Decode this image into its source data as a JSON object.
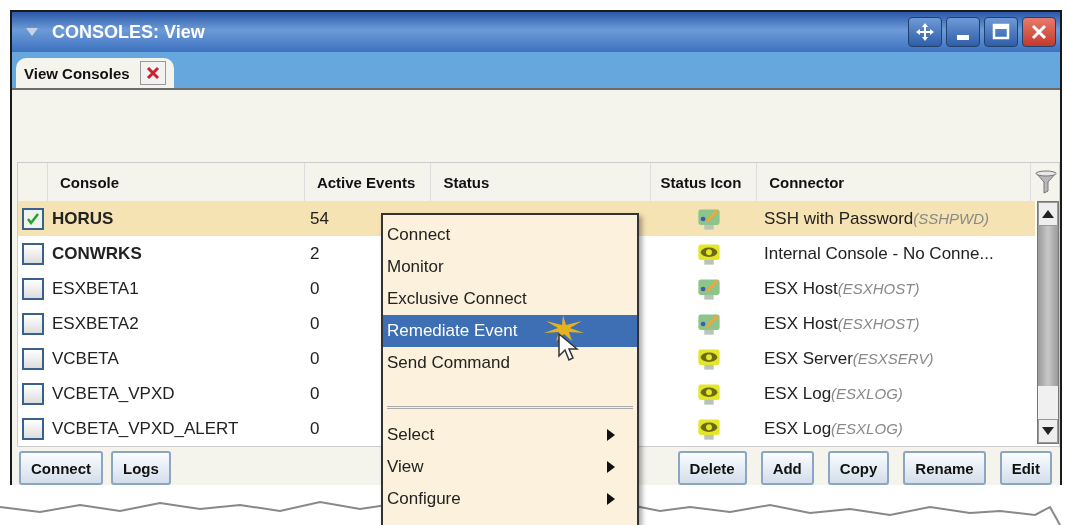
{
  "window": {
    "title": "CONSOLES: View"
  },
  "tabs": [
    {
      "label": "View Consoles",
      "selected": true
    }
  ],
  "table": {
    "columns": [
      "Console",
      "Active Events",
      "Status",
      "Status Icon",
      "Connector"
    ],
    "rows": [
      {
        "checked": true,
        "selected": true,
        "emphasized": true,
        "console": "HORUS",
        "active_events": "54",
        "status_icon": {
          "kind": "edit"
        },
        "connector": "SSH with Password",
        "connector_code": "(SSHPWD)"
      },
      {
        "checked": false,
        "selected": false,
        "emphasized": true,
        "console": "CONWRKS",
        "active_events": "2",
        "status_icon": {
          "kind": "watch"
        },
        "connector": "Internal Console - No Conne...",
        "connector_code": ""
      },
      {
        "checked": false,
        "selected": false,
        "emphasized": false,
        "console": "ESXBETA1",
        "active_events": "0",
        "status_icon": {
          "kind": "edit"
        },
        "connector": "ESX Host",
        "connector_code": "(ESXHOST)"
      },
      {
        "checked": false,
        "selected": false,
        "emphasized": false,
        "console": "ESXBETA2",
        "active_events": "0",
        "status_icon": {
          "kind": "edit"
        },
        "connector": "ESX Host",
        "connector_code": "(ESXHOST)"
      },
      {
        "checked": false,
        "selected": false,
        "emphasized": false,
        "console": "VCBETA",
        "active_events": "0",
        "status_icon": {
          "kind": "watch"
        },
        "connector": "ESX Server",
        "connector_code": "(ESXSERV)"
      },
      {
        "checked": false,
        "selected": false,
        "emphasized": false,
        "console": "VCBETA_VPXD",
        "active_events": "0",
        "status_icon": {
          "kind": "watch"
        },
        "connector": "ESX Log",
        "connector_code": "(ESXLOG)"
      },
      {
        "checked": false,
        "selected": false,
        "emphasized": false,
        "console": "VCBETA_VPXD_ALERT",
        "active_events": "0",
        "status_icon": {
          "kind": "watch"
        },
        "connector": "ESX Log",
        "connector_code": "(ESXLOG)"
      }
    ]
  },
  "left_buttons": [
    "Connect",
    "Logs"
  ],
  "right_buttons": [
    "Delete",
    "Add",
    "Copy",
    "Rename",
    "Edit"
  ],
  "context_menu": {
    "items": [
      {
        "kind": "item",
        "label": "Connect",
        "selected": false
      },
      {
        "kind": "item",
        "label": "Monitor",
        "selected": false
      },
      {
        "kind": "item",
        "label": "Exclusive Connect",
        "selected": false
      },
      {
        "kind": "item",
        "label": "Remediate Event",
        "selected": true
      },
      {
        "kind": "item",
        "label": "Send Command",
        "selected": false
      },
      {
        "kind": "separator"
      },
      {
        "kind": "submenu",
        "label": "Select",
        "selected": false
      },
      {
        "kind": "submenu",
        "label": "View",
        "selected": false
      },
      {
        "kind": "submenu",
        "label": "Configure",
        "selected": false
      }
    ]
  }
}
